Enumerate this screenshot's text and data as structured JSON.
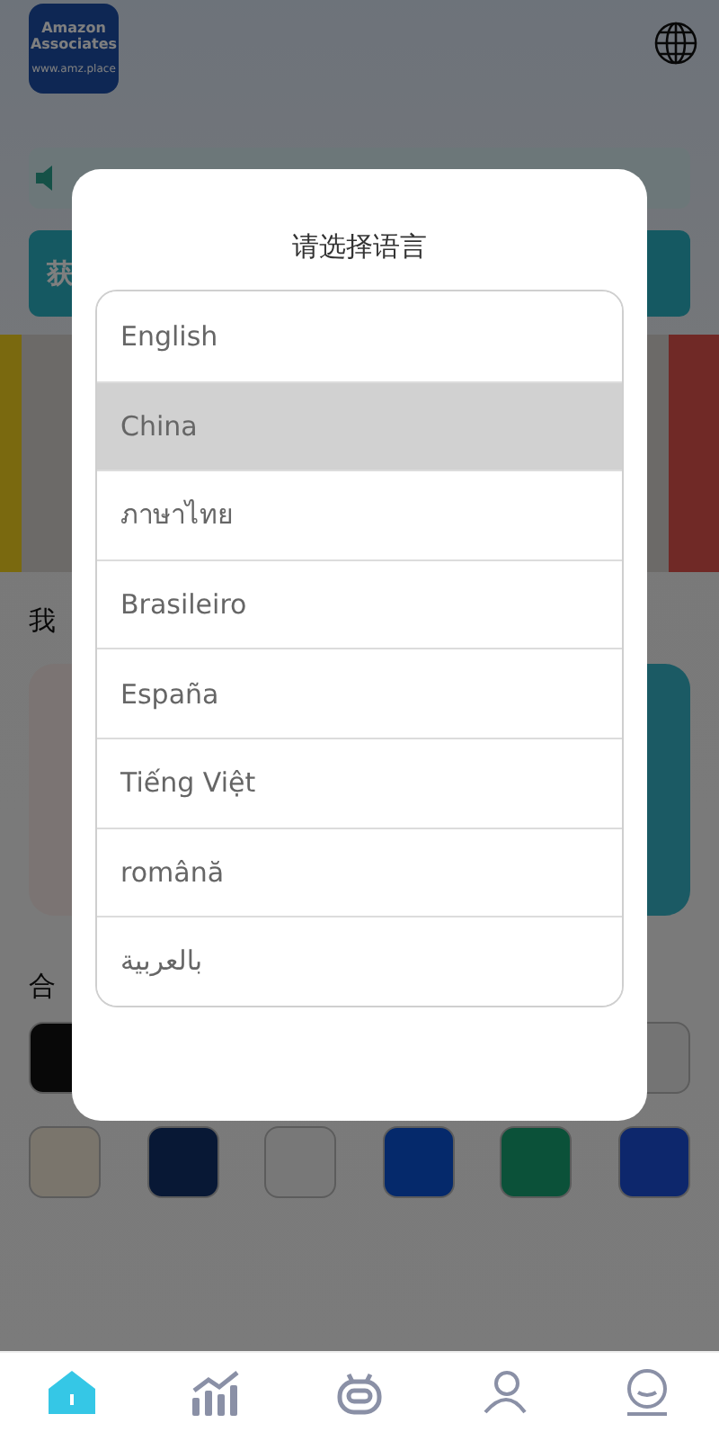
{
  "header": {
    "logo_lines": [
      "Amazon",
      "Associates"
    ],
    "logo_url": "www.amz.place"
  },
  "background": {
    "action_label": "获",
    "section_mine": "我",
    "section_partners": "合"
  },
  "dialog": {
    "title": "请选择语言",
    "languages": [
      {
        "label": "English",
        "selected": false
      },
      {
        "label": "China",
        "selected": true
      },
      {
        "label": "ภาษาไทย",
        "selected": false
      },
      {
        "label": "Brasileiro",
        "selected": false
      },
      {
        "label": "España",
        "selected": false
      },
      {
        "label": "Tiếng Việt",
        "selected": false
      },
      {
        "label": "română",
        "selected": false
      },
      {
        "label": "بالعربية",
        "selected": false
      }
    ]
  },
  "nav": [
    {
      "kind": "home",
      "selected": true
    },
    {
      "kind": "chart",
      "selected": false
    },
    {
      "kind": "robot",
      "selected": false
    },
    {
      "kind": "team",
      "selected": false
    },
    {
      "kind": "profile",
      "selected": false
    }
  ]
}
